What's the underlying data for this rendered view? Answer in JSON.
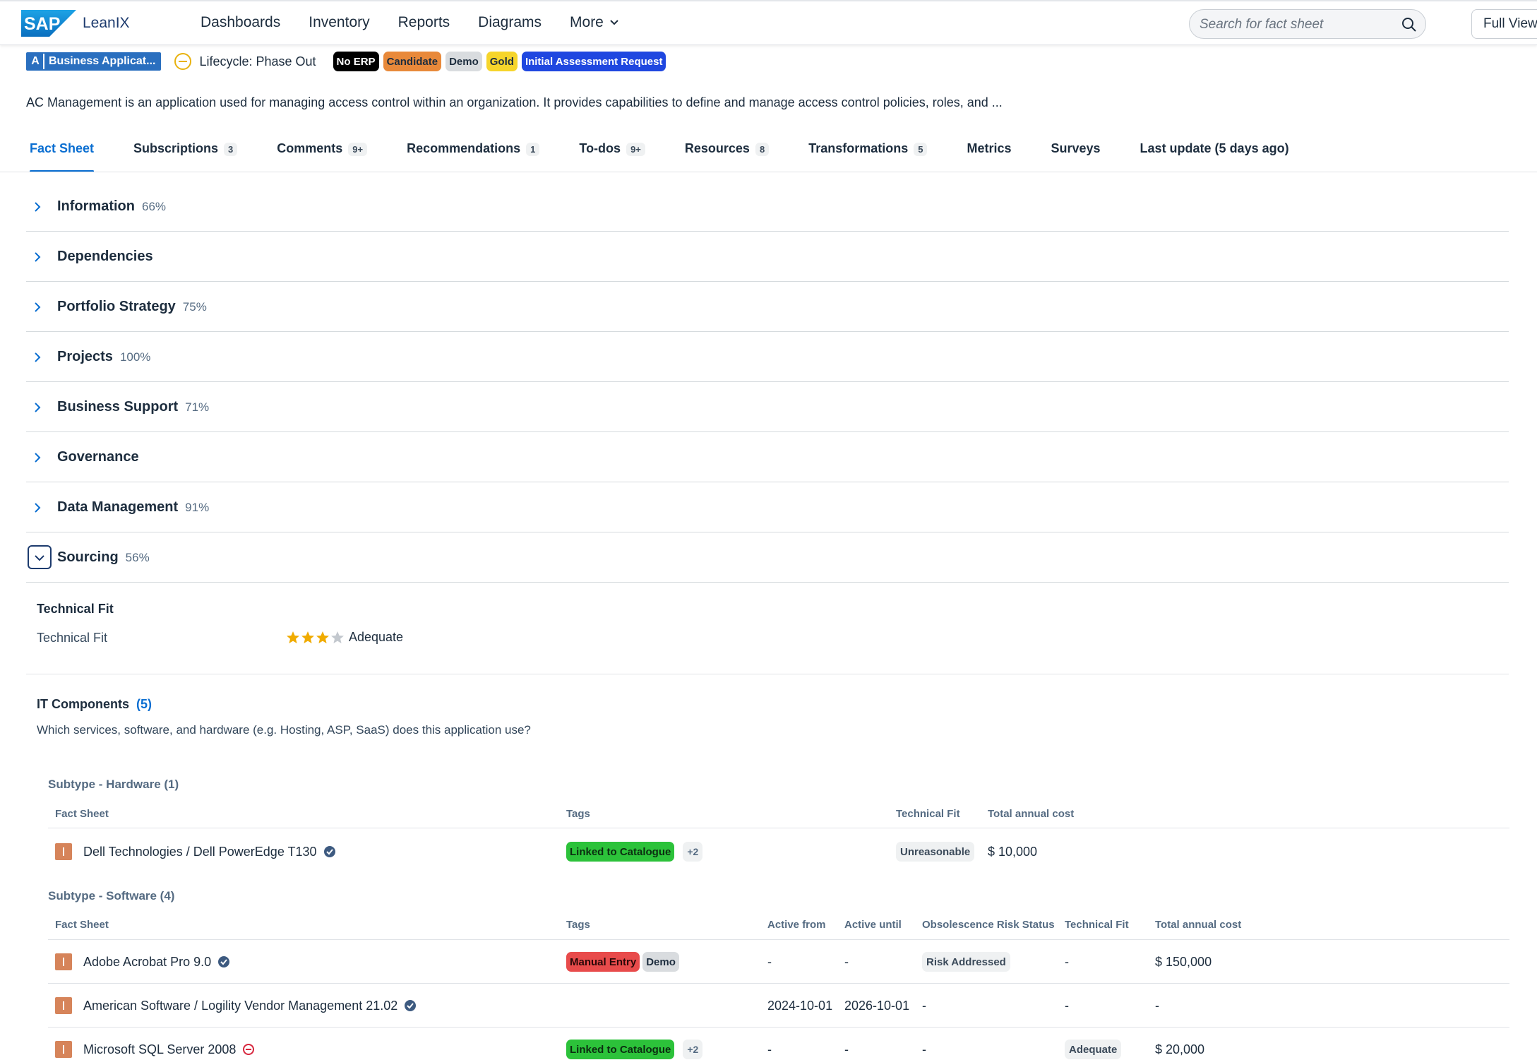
{
  "app": {
    "logo_text": "LeanIX",
    "nav": [
      "Dashboards",
      "Inventory",
      "Reports",
      "Diagrams",
      "More"
    ],
    "search_placeholder": "Search for fact sheet",
    "full_view_label": "Full View"
  },
  "header": {
    "type_letter": "A",
    "type_name": "Business Applicat...",
    "lifecycle": "Lifecycle: Phase Out",
    "tags": [
      {
        "label": "No ERP",
        "bg": "#000000",
        "fg": "#ffffff"
      },
      {
        "label": "Candidate",
        "bg": "#e8893a",
        "fg": "#1d2d3e"
      },
      {
        "label": "Demo",
        "bg": "#d9dcdf",
        "fg": "#1d2d3e"
      },
      {
        "label": "Gold",
        "bg": "#f6d52b",
        "fg": "#1d2d3e"
      },
      {
        "label": "Initial Assessment Request",
        "bg": "#1f47e0",
        "fg": "#ffffff"
      }
    ],
    "description": "AC Management is an application used for managing access control within an organization. It provides capabilities to define and manage access control policies, roles, and ..."
  },
  "tabs": [
    {
      "label": "Fact Sheet",
      "count": ""
    },
    {
      "label": "Subscriptions",
      "count": "3"
    },
    {
      "label": "Comments",
      "count": "9+"
    },
    {
      "label": "Recommendations",
      "count": "1"
    },
    {
      "label": "To-dos",
      "count": "9+"
    },
    {
      "label": "Resources",
      "count": "8"
    },
    {
      "label": "Transformations",
      "count": "5"
    },
    {
      "label": "Metrics",
      "count": ""
    },
    {
      "label": "Surveys",
      "count": ""
    },
    {
      "label": "Last update (5 days ago)",
      "count": ""
    }
  ],
  "sections": [
    {
      "title": "Information",
      "pct": "66%"
    },
    {
      "title": "Dependencies",
      "pct": ""
    },
    {
      "title": "Portfolio Strategy",
      "pct": "75%"
    },
    {
      "title": "Projects",
      "pct": "100%"
    },
    {
      "title": "Business Support",
      "pct": "71%"
    },
    {
      "title": "Governance",
      "pct": ""
    },
    {
      "title": "Data Management",
      "pct": "91%"
    },
    {
      "title": "Sourcing",
      "pct": "56%"
    }
  ],
  "sourcing": {
    "technical_fit_heading": "Technical Fit",
    "technical_fit_label": "Technical Fit",
    "technical_fit_stars": 3,
    "technical_fit_max": 4,
    "technical_fit_value": "Adequate",
    "it_components_title": "IT Components",
    "it_components_count": "(5)",
    "it_components_desc": "Which services, software, and hardware (e.g. Hosting, ASP, SaaS) does this application use?"
  },
  "hardware": {
    "title": "Subtype - Hardware (1)",
    "headers": [
      "Fact Sheet",
      "Tags",
      "Technical Fit",
      "Total annual cost"
    ],
    "rows": [
      {
        "name": "Dell Technologies / Dell PowerEdge T130",
        "tag": "Linked to Catalogue",
        "more": "+2",
        "fit": "Unreasonable",
        "cost": "$ 10,000"
      }
    ]
  },
  "software": {
    "title": "Subtype - Software (4)",
    "headers": [
      "Fact Sheet",
      "Tags",
      "Active from",
      "Active until",
      "Obsolescence Risk Status",
      "Technical Fit",
      "Total annual cost"
    ],
    "rows": [
      {
        "name": "Adobe Acrobat Pro 9.0",
        "tag1": "Manual Entry",
        "tag2": "Demo",
        "from": "-",
        "until": "-",
        "risk": "Risk Addressed",
        "fit": "-",
        "cost": "$ 150,000"
      },
      {
        "name": "American Software / Logility Vendor Management 21.02",
        "from": "2024-10-01",
        "until": "2026-10-01",
        "risk": "-",
        "fit": "-",
        "cost": "-"
      },
      {
        "name": "Microsoft SQL Server 2008",
        "tag1": "Linked to Catalogue",
        "more": "+2",
        "from": "-",
        "until": "-",
        "risk": "-",
        "fit": "Adequate",
        "cost": "$ 20,000"
      }
    ]
  },
  "colors": {
    "accent": "#0a6ed1",
    "linked_catalogue": "#2cc23a",
    "manual_entry": "#e84b4b",
    "it_component": "#d6845a"
  }
}
